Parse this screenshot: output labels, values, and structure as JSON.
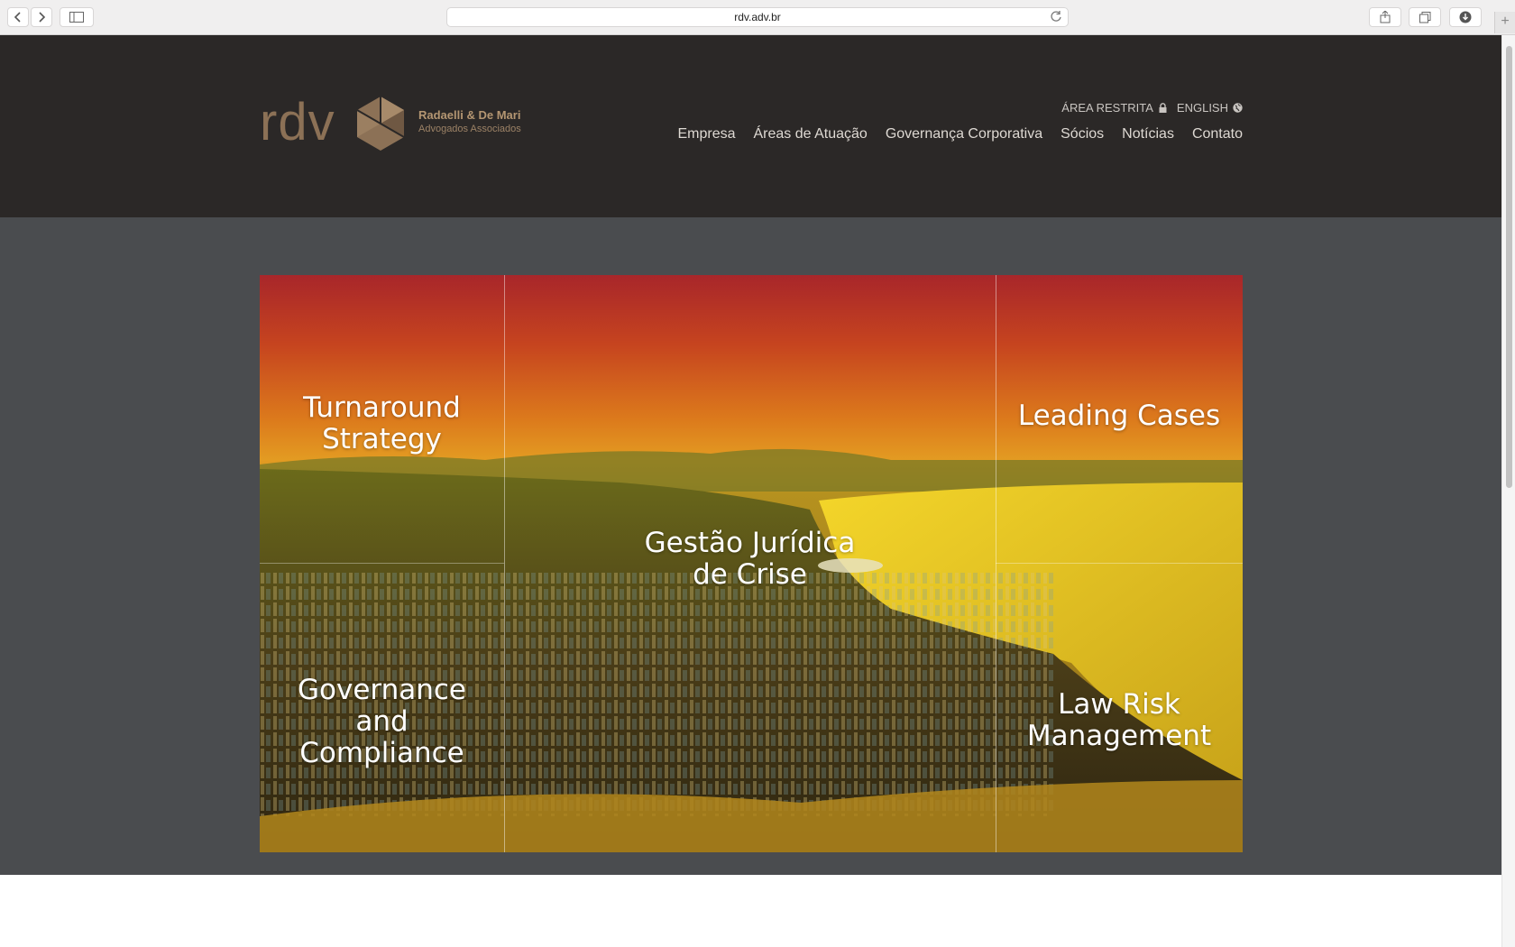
{
  "browser": {
    "url": "rdv.adv.br",
    "new_tab_symbol": "+"
  },
  "logo": {
    "mark_text": "rdv",
    "name": "Radaelli & De Mari",
    "subtitle": "Advogados Associados"
  },
  "utility_links": [
    {
      "label": "ÁREA RESTRITA",
      "icon": "lock-icon"
    },
    {
      "label": "ENGLISH",
      "icon": "globe-icon"
    }
  ],
  "nav": {
    "items": [
      "Empresa",
      "Áreas de Atuação",
      "Governança Corporativa",
      "Sócios",
      "Notícias",
      "Contato"
    ]
  },
  "hero": {
    "tiles": [
      {
        "id": "turnaround",
        "lines": [
          "Turnaround",
          "Strategy"
        ]
      },
      {
        "id": "leading",
        "lines": [
          "Leading Cases"
        ]
      },
      {
        "id": "gestao",
        "lines": [
          "Gestão Jurídica",
          "de Crise"
        ]
      },
      {
        "id": "governance",
        "lines": [
          "Governance",
          "and",
          "Compliance"
        ]
      },
      {
        "id": "lawrisk",
        "lines": [
          "Law Risk",
          "Management"
        ]
      }
    ]
  },
  "colors": {
    "header_bg": "#2b2827",
    "page_bg": "#4a4c4f",
    "logo_brown": "#8c7156",
    "logo_gold": "#b49672"
  }
}
